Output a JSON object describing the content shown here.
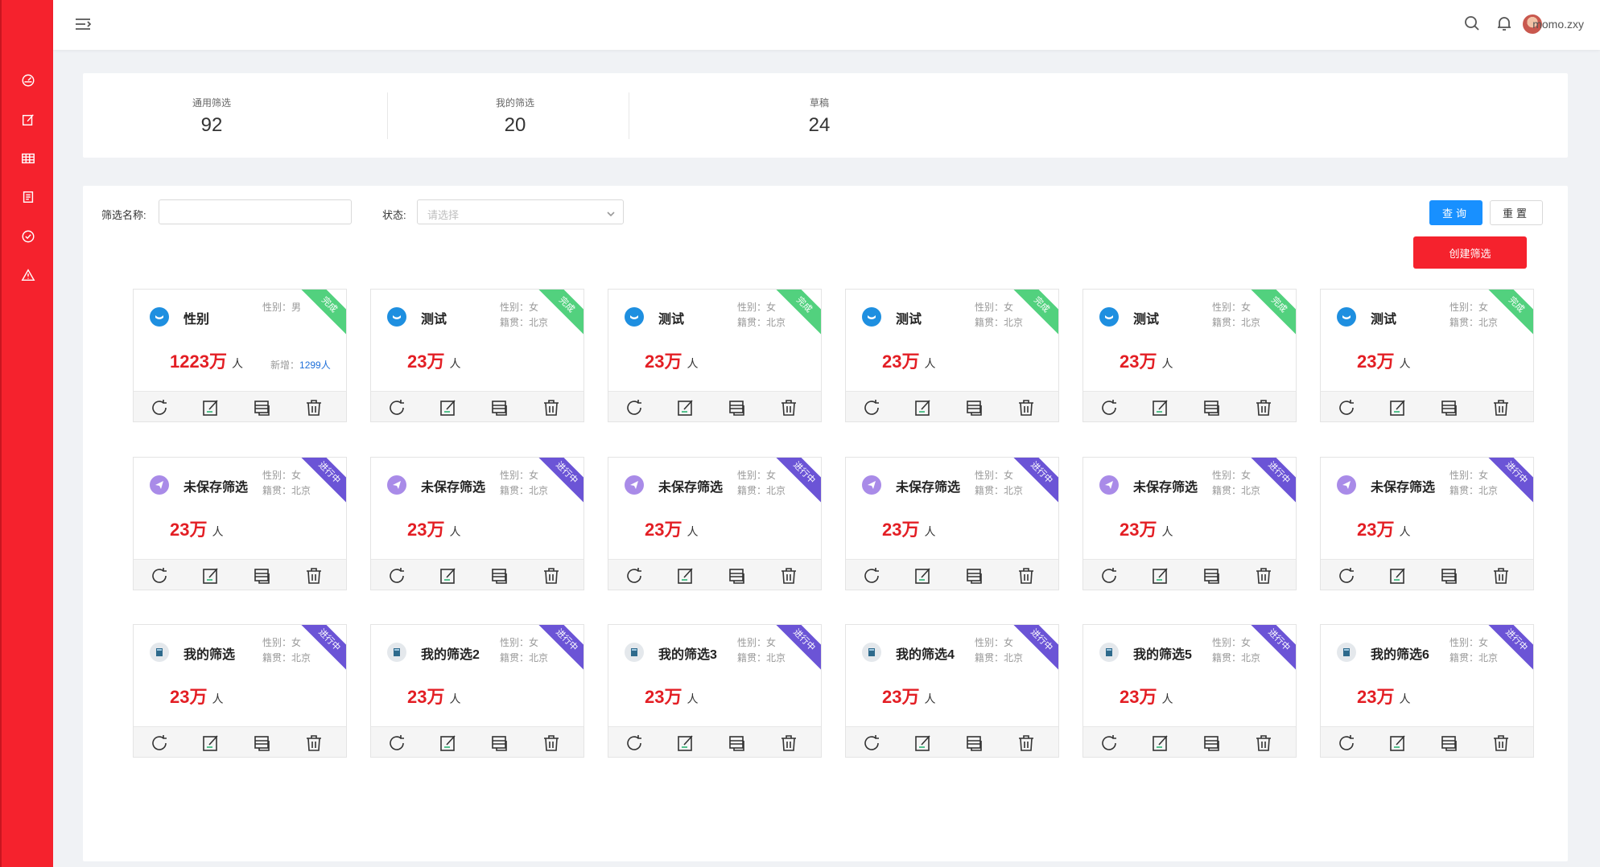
{
  "topbar": {
    "username": "momo.zxy"
  },
  "stats": [
    {
      "label": "通用筛选",
      "value": "92"
    },
    {
      "label": "我的筛选",
      "value": "20"
    },
    {
      "label": "草稿",
      "value": "24"
    }
  ],
  "filters": {
    "name_label": "筛选名称:",
    "status_label": "状态:",
    "status_placeholder": "请选择",
    "query_label": "查询",
    "reset_label": "重置",
    "create_label": "创建筛选"
  },
  "colors": {
    "accent": "#f5222d",
    "primary": "#1890ff",
    "done": "#52d17e",
    "progress": "#6b54d6",
    "count": "#e31e24"
  },
  "rows": [
    [
      {
        "icon": "blue-circle-icon",
        "title": "性别",
        "attr1": "性别：男",
        "attr2": "",
        "count": "1223万",
        "unit": "人",
        "new_label": "新增：",
        "new_value": "1299人",
        "status": "完成",
        "status_type": "done"
      },
      {
        "icon": "blue-circle-icon",
        "title": "测试",
        "attr1": "性别：女",
        "attr2": "籍贯：北京",
        "count": "23万",
        "unit": "人",
        "status": "完成",
        "status_type": "done"
      },
      {
        "icon": "blue-circle-icon",
        "title": "测试",
        "attr1": "性别：女",
        "attr2": "籍贯：北京",
        "count": "23万",
        "unit": "人",
        "status": "完成",
        "status_type": "done"
      },
      {
        "icon": "blue-circle-icon",
        "title": "测试",
        "attr1": "性别：女",
        "attr2": "籍贯：北京",
        "count": "23万",
        "unit": "人",
        "status": "完成",
        "status_type": "done"
      },
      {
        "icon": "blue-circle-icon",
        "title": "测试",
        "attr1": "性别：女",
        "attr2": "籍贯：北京",
        "count": "23万",
        "unit": "人",
        "status": "完成",
        "status_type": "done"
      },
      {
        "icon": "blue-circle-icon",
        "title": "测试",
        "attr1": "性别：女",
        "attr2": "籍贯：北京",
        "count": "23万",
        "unit": "人",
        "status": "完成",
        "status_type": "done"
      }
    ],
    [
      {
        "icon": "paper-plane-icon",
        "title": "未保存筛选",
        "attr1": "性别：女",
        "attr2": "籍贯：北京",
        "count": "23万",
        "unit": "人",
        "status": "进行中",
        "status_type": "progress"
      },
      {
        "icon": "paper-plane-icon",
        "title": "未保存筛选",
        "attr1": "性别：女",
        "attr2": "籍贯：北京",
        "count": "23万",
        "unit": "人",
        "status": "进行中",
        "status_type": "progress"
      },
      {
        "icon": "paper-plane-icon",
        "title": "未保存筛选",
        "attr1": "性别：女",
        "attr2": "籍贯：北京",
        "count": "23万",
        "unit": "人",
        "status": "进行中",
        "status_type": "progress"
      },
      {
        "icon": "paper-plane-icon",
        "title": "未保存筛选",
        "attr1": "性别：女",
        "attr2": "籍贯：北京",
        "count": "23万",
        "unit": "人",
        "status": "进行中",
        "status_type": "progress"
      },
      {
        "icon": "paper-plane-icon",
        "title": "未保存筛选",
        "attr1": "性别：女",
        "attr2": "籍贯：北京",
        "count": "23万",
        "unit": "人",
        "status": "进行中",
        "status_type": "progress"
      },
      {
        "icon": "paper-plane-icon",
        "title": "未保存筛选",
        "attr1": "性别：女",
        "attr2": "籍贯：北京",
        "count": "23万",
        "unit": "人",
        "status": "进行中",
        "status_type": "progress"
      }
    ],
    [
      {
        "icon": "book-icon",
        "title": "我的筛选",
        "attr1": "性别：女",
        "attr2": "籍贯：北京",
        "count": "23万",
        "unit": "人",
        "status": "进行中",
        "status_type": "progress"
      },
      {
        "icon": "book-icon",
        "title": "我的筛选2",
        "attr1": "性别：女",
        "attr2": "籍贯：北京",
        "count": "23万",
        "unit": "人",
        "status": "进行中",
        "status_type": "progress"
      },
      {
        "icon": "book-icon",
        "title": "我的筛选3",
        "attr1": "性别：女",
        "attr2": "籍贯：北京",
        "count": "23万",
        "unit": "人",
        "status": "进行中",
        "status_type": "progress"
      },
      {
        "icon": "book-icon",
        "title": "我的筛选4",
        "attr1": "性别：女",
        "attr2": "籍贯：北京",
        "count": "23万",
        "unit": "人",
        "status": "进行中",
        "status_type": "progress"
      },
      {
        "icon": "book-icon",
        "title": "我的筛选5",
        "attr1": "性别：女",
        "attr2": "籍贯：北京",
        "count": "23万",
        "unit": "人",
        "status": "进行中",
        "status_type": "progress"
      },
      {
        "icon": "book-icon",
        "title": "我的筛选6",
        "attr1": "性别：女",
        "attr2": "籍贯：北京",
        "count": "23万",
        "unit": "人",
        "status": "进行中",
        "status_type": "progress"
      }
    ]
  ]
}
